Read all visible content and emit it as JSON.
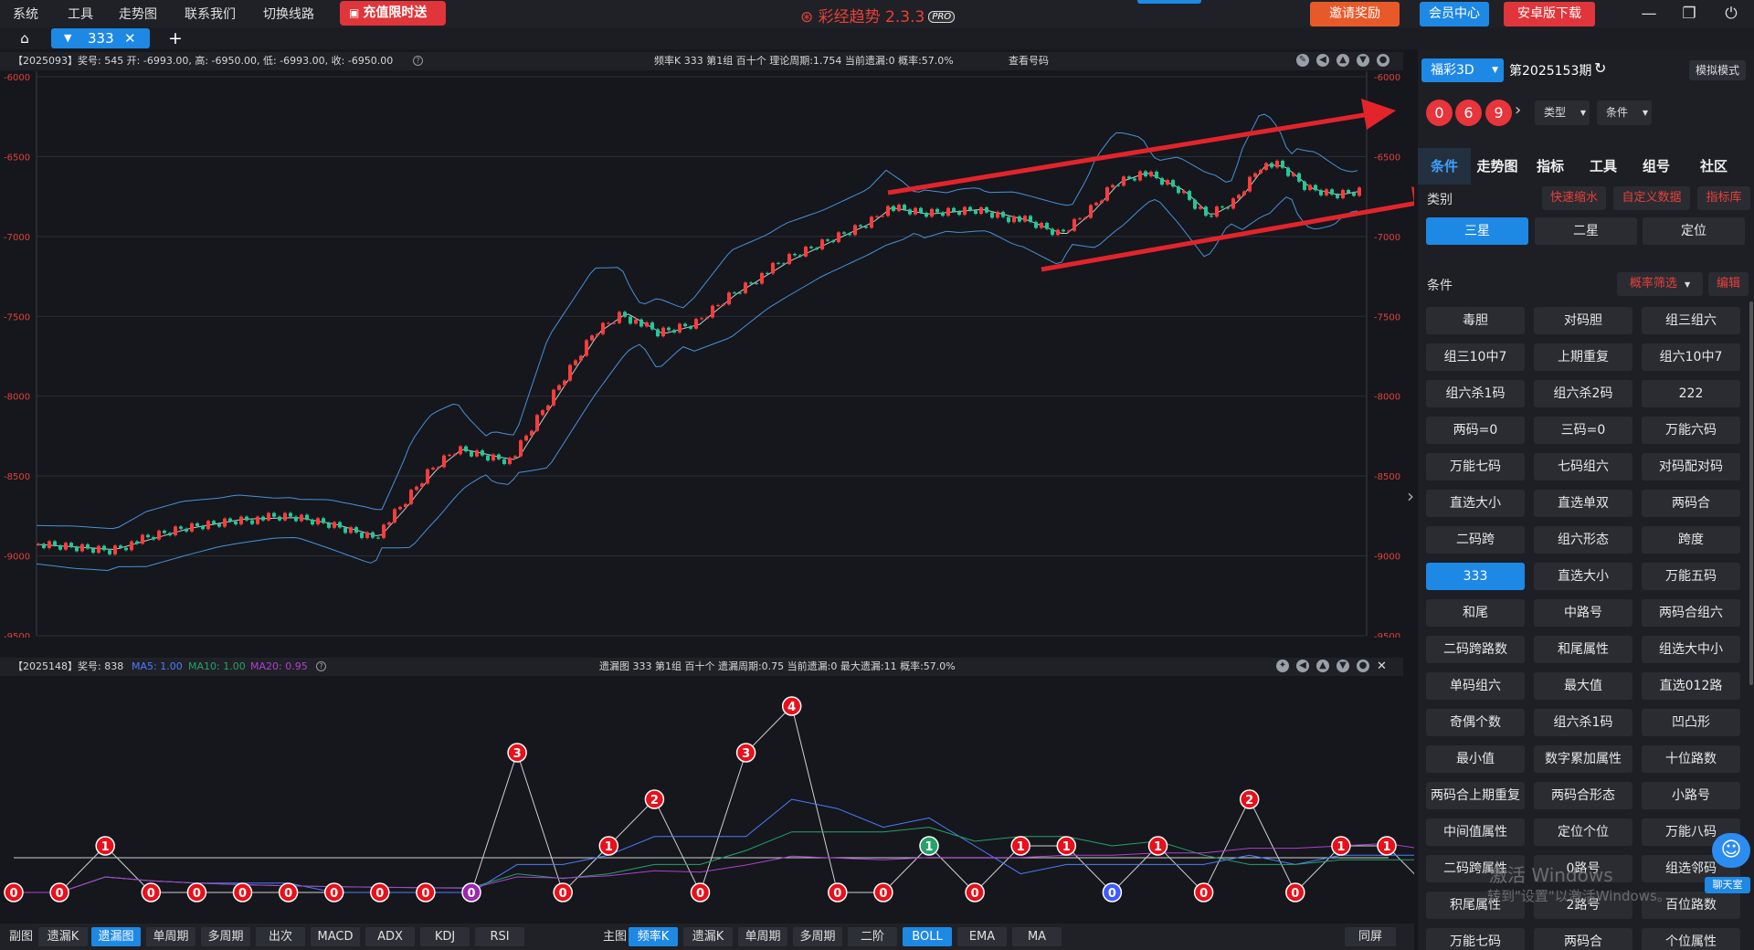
{
  "menu": [
    "系统",
    "工具",
    "走势图",
    "联系我们",
    "切换线路"
  ],
  "promo": "充值限时送",
  "brand": {
    "name": "彩经趋势 2.3.3",
    "badge": "PRO"
  },
  "top_buttons": {
    "invite": "邀请奖励",
    "member": "会员中心",
    "android": "安卓版下载"
  },
  "tab": {
    "label": "333",
    "close": "✕",
    "add": "+"
  },
  "upper_chart": {
    "info_left": "【2025093】奖号: 545   开: -6993.00, 高: -6950.00, 低: -6993.00, 收: -6950.00",
    "info_mid": "频率K   333   第1组   百十个   理论周期:1.754   当前遗漏:0   概率:57.0%",
    "info_right": "查看号码",
    "y_ticks": [
      -6000,
      -6500,
      -7000,
      -7500,
      -8000,
      -8500,
      -9000,
      -9500
    ]
  },
  "lower_chart": {
    "info_left": "【2025148】奖号: 838",
    "ma5": "MA5: 1.00",
    "ma10": "MA10: 1.00",
    "ma20": "MA20: 0.95",
    "info_mid": "遗漏图   333   第1组   百十个   遗漏周期:0.75   当前遗漏:0   最大遗漏:11   概率:57.0%",
    "points": [
      0,
      0,
      1,
      0,
      0,
      0,
      0,
      0,
      0,
      0,
      0,
      3,
      0,
      1,
      2,
      0,
      3,
      4,
      0,
      0,
      1,
      0,
      1,
      1,
      0,
      1,
      0,
      2,
      0,
      1,
      1,
      0
    ],
    "special": {
      "10": "#9c27b0",
      "20": "#26a269",
      "24": "#3d5afe",
      "31": "#3d5afe"
    }
  },
  "bottom": {
    "sub_label": "副图",
    "sub": [
      "遗漏K",
      "遗漏图",
      "单周期",
      "多周期",
      "出次",
      "MACD",
      "ADX",
      "KDJ",
      "RSI"
    ],
    "main_label": "主图",
    "main": [
      "频率K",
      "遗漏K",
      "单周期",
      "多周期",
      "二阶",
      "BOLL",
      "EMA",
      "MA"
    ],
    "same": "同屏"
  },
  "sidebar": {
    "lottery": "福彩3D",
    "period": "第2025153期",
    "sim_mode": "模拟模式",
    "balls": [
      "0",
      "6",
      "9"
    ],
    "type_dd": "类型",
    "cond_dd": "条件",
    "tabs": [
      "条件",
      "走势图",
      "指标",
      "工具",
      "组号",
      "社区"
    ],
    "category": "类别",
    "links": [
      "快速缩水",
      "自定义数据",
      "指标库"
    ],
    "seg": [
      "三星",
      "二星",
      "定位"
    ],
    "cond_label": "条件",
    "filter": "概率筛选",
    "edit": "编辑",
    "conds": [
      "毒胆",
      "对码胆",
      "组三组六",
      "组三10中7",
      "上期重复",
      "组六10中7",
      "组六杀1码",
      "组六杀2码",
      "222",
      "两码=0",
      "三码=0",
      "万能六码",
      "万能七码",
      "七码组六",
      "对码配对码",
      "直选大小",
      "直选单双",
      "两码合",
      "二码跨",
      "组六形态",
      "跨度",
      "333",
      "直选大小",
      "万能五码",
      "和尾",
      "中路号",
      "两码合组六",
      "二码跨路数",
      "和尾属性",
      "组选大中小",
      "单码组六",
      "最大值",
      "直选012路",
      "奇偶个数",
      "组六杀1码",
      "凹凸形",
      "最小值",
      "数字累加属性",
      "十位路数",
      "两码合上期重复",
      "两码合形态",
      "小路号",
      "中间值属性",
      "定位个位",
      "万能八码",
      "二码跨属性",
      "0路号",
      "组选邻码",
      "积尾属性",
      "2路号",
      "百位路数",
      "万能七码",
      "两码合",
      "个位属性"
    ],
    "active_cond": 21
  },
  "watermark": {
    "line1": "激活 Windows",
    "line2": "转到\"设置\"以激活Windows。"
  },
  "chat": "聊天室"
}
